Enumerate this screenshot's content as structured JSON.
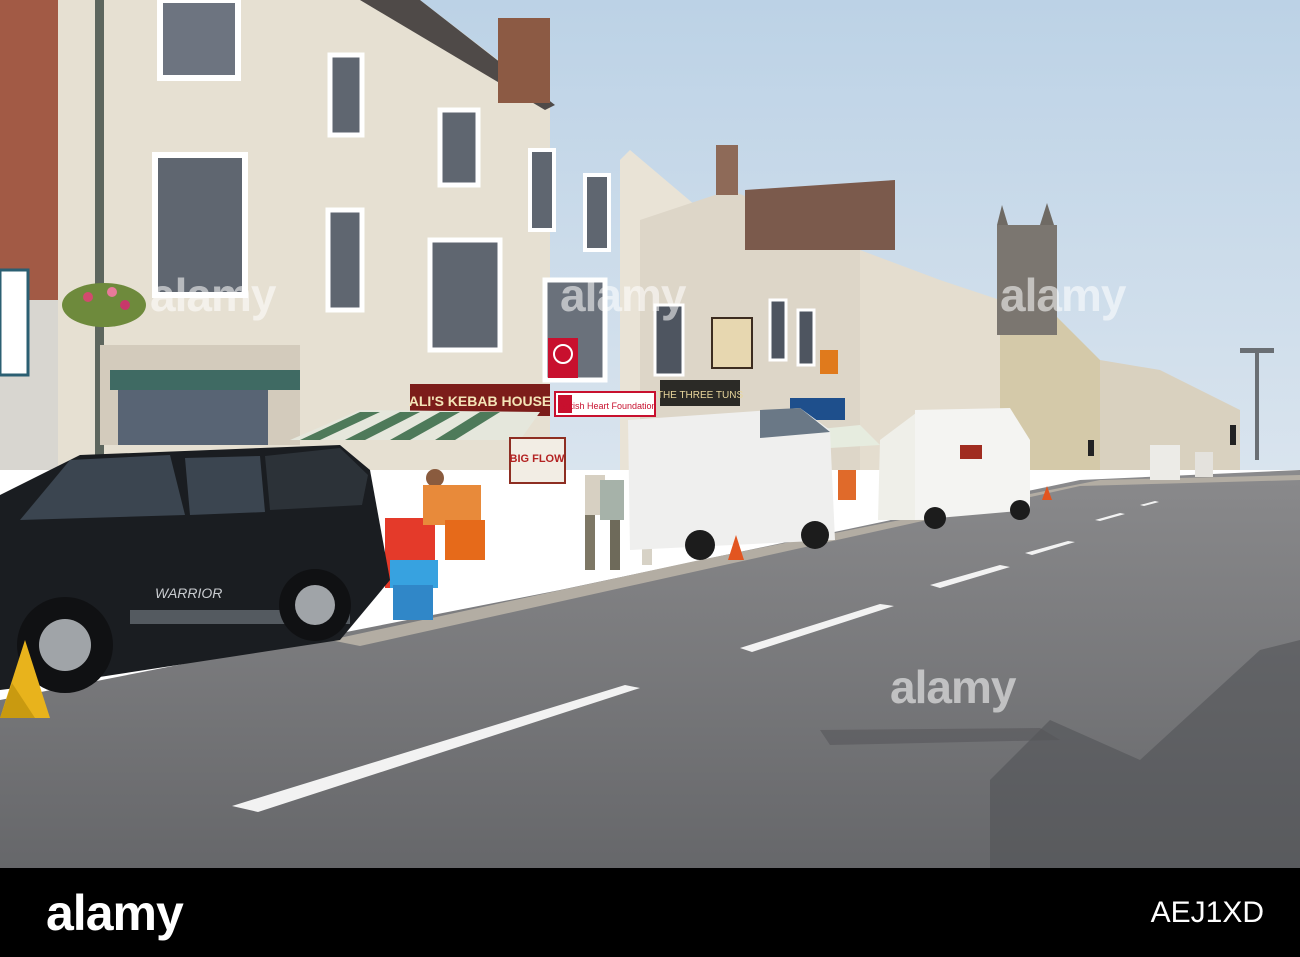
{
  "photo": {
    "description_tags": [
      "street-scene",
      "market-stall",
      "parked-vehicles",
      "shopfronts"
    ],
    "signs": {
      "kebab_house": "ALI'S KEBAB HOUSE",
      "british_heart": "British Heart Foundation",
      "sale_banner": "BIG FLOW",
      "pub_sign": "THE THREE TUNS",
      "warrior_badge": "WARRIOR"
    }
  },
  "watermark": {
    "text": "alamy"
  },
  "stock_bar": {
    "logo": "alamy",
    "image_id": "AEJ1XD",
    "background": "#000000"
  }
}
